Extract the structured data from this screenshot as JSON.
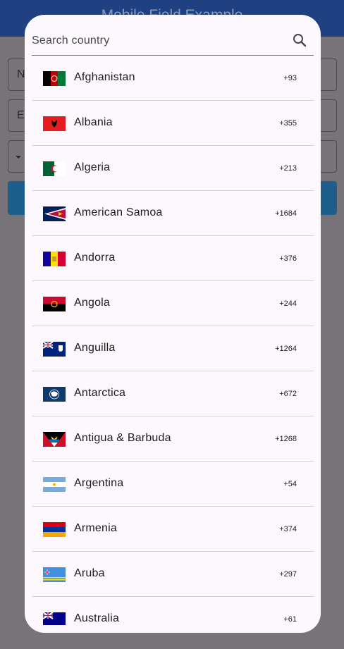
{
  "app": {
    "title": "Mobile Field Example",
    "fields": [
      "N",
      "E"
    ]
  },
  "dialog": {
    "search": {
      "placeholder": "Search country",
      "value": ""
    },
    "countries": [
      {
        "name": "Afghanistan",
        "code": "+93"
      },
      {
        "name": "Albania",
        "code": "+355"
      },
      {
        "name": "Algeria",
        "code": "+213"
      },
      {
        "name": "American Samoa",
        "code": "+1684"
      },
      {
        "name": "Andorra",
        "code": "+376"
      },
      {
        "name": "Angola",
        "code": "+244"
      },
      {
        "name": "Anguilla",
        "code": "+1264"
      },
      {
        "name": "Antarctica",
        "code": "+672"
      },
      {
        "name": "Antigua & Barbuda",
        "code": "+1268"
      },
      {
        "name": "Argentina",
        "code": "+54"
      },
      {
        "name": "Armenia",
        "code": "+374"
      },
      {
        "name": "Aruba",
        "code": "+297"
      },
      {
        "name": "Australia",
        "code": "+61"
      }
    ]
  },
  "colors": {
    "appbar": "#1f4081",
    "dialog_bg": "#fdf7fe",
    "scrim": "#787378",
    "button": "#1e5e8c"
  }
}
